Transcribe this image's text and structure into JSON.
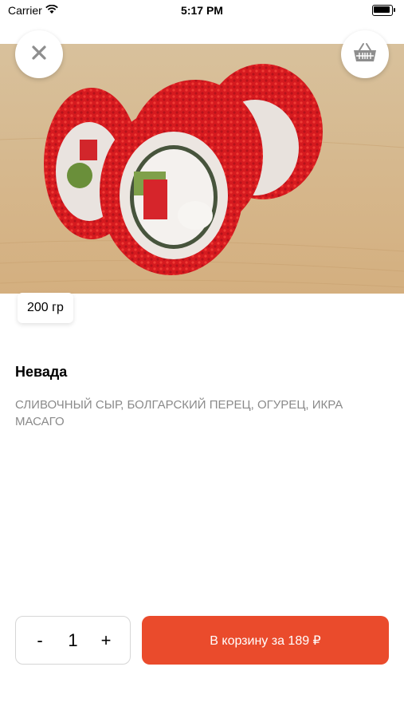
{
  "status_bar": {
    "carrier": "Carrier",
    "time": "5:17 PM"
  },
  "header": {
    "close_icon": "close-icon",
    "basket_icon": "basket-icon"
  },
  "product": {
    "weight": "200 гр",
    "title": "Невада",
    "description": "СЛИВОЧНЫЙ СЫР, БОЛГАРСКИЙ ПЕРЕЦ, ОГУРЕЦ, ИКРА МАСАГО"
  },
  "cart": {
    "minus_label": "-",
    "quantity": "1",
    "plus_label": "+",
    "add_button_label": "В корзину за 189 ₽"
  },
  "colors": {
    "accent": "#ea4b2c"
  }
}
